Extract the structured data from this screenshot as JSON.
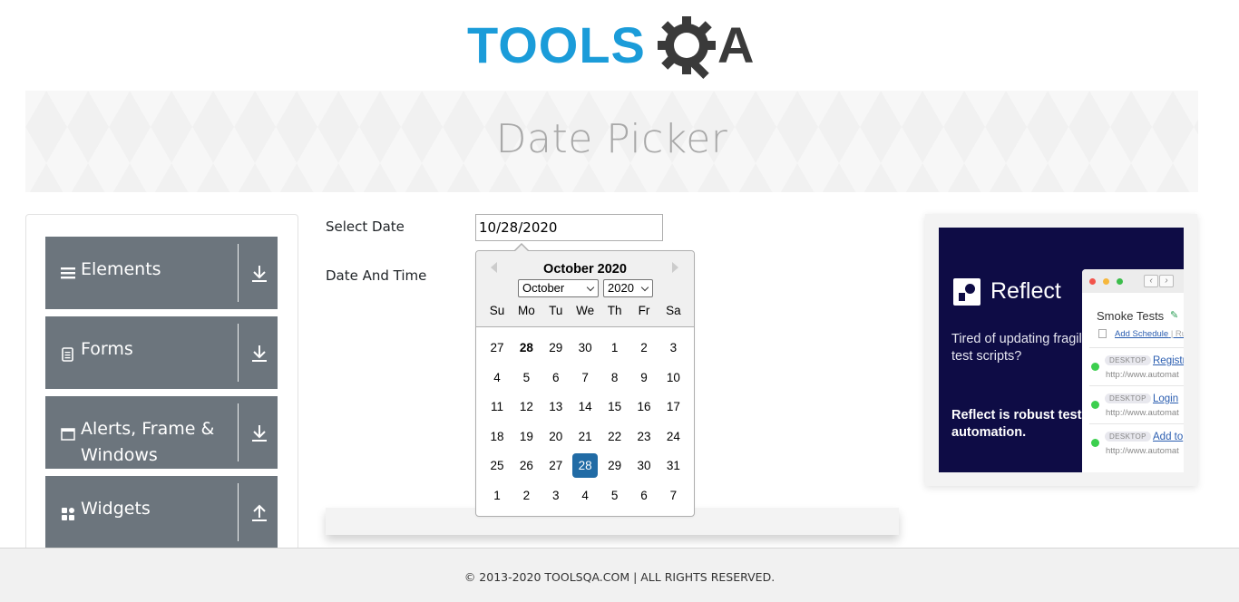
{
  "logo": {
    "main": "TOOLS",
    "suffix": "A"
  },
  "banner": {
    "title": "Date Picker"
  },
  "sidebar": {
    "groups": [
      {
        "label": "Elements",
        "icon": "hamburger-icon",
        "arrow": "download-arrow-icon"
      },
      {
        "label": "Forms",
        "icon": "document-icon",
        "arrow": "download-arrow-icon"
      },
      {
        "label": "Alerts, Frame & Windows",
        "icon": "window-icon",
        "arrow": "download-arrow-icon"
      },
      {
        "label": "Widgets",
        "icon": "widgets-icon",
        "arrow": "upload-arrow-icon"
      }
    ]
  },
  "form": {
    "select_date_label": "Select Date",
    "select_date_value": "10/28/2020",
    "date_time_label": "Date And Time"
  },
  "calendar": {
    "month_title": "October 2020",
    "month_select": "October",
    "year_select": "2020",
    "weekdays": [
      "Su",
      "Mo",
      "Tu",
      "We",
      "Th",
      "Fr",
      "Sa"
    ],
    "weeks": [
      [
        "27",
        "28",
        "29",
        "30",
        "1",
        "2",
        "3"
      ],
      [
        "4",
        "5",
        "6",
        "7",
        "8",
        "9",
        "10"
      ],
      [
        "11",
        "12",
        "13",
        "14",
        "15",
        "16",
        "17"
      ],
      [
        "18",
        "19",
        "20",
        "21",
        "22",
        "23",
        "24"
      ],
      [
        "25",
        "26",
        "27",
        "28",
        "29",
        "30",
        "31"
      ],
      [
        "1",
        "2",
        "3",
        "4",
        "5",
        "6",
        "7"
      ]
    ],
    "today_marker": {
      "week": 0,
      "day": 1
    },
    "selected": {
      "week": 4,
      "day": 3
    },
    "selected_color": "#216ba5"
  },
  "ad": {
    "brand": "Reflect",
    "copy1": "Tired of updating fragile test scripts?",
    "copy2": "Reflect is robust test automation.",
    "panel_title": "Smoke Tests",
    "schedule_link": "Add Schedule",
    "schedule_more": "| Ru",
    "rows": [
      {
        "tag": "DESKTOP",
        "link": "Registr",
        "url": "http://www.automat"
      },
      {
        "tag": "DESKTOP",
        "link": "Login",
        "url": "http://www.automat"
      },
      {
        "tag": "DESKTOP",
        "link": "Add to",
        "url": "http://www.automat"
      }
    ]
  },
  "footer": {
    "text": "© 2013-2020 TOOLSQA.COM | ALL RIGHTS RESERVED."
  }
}
